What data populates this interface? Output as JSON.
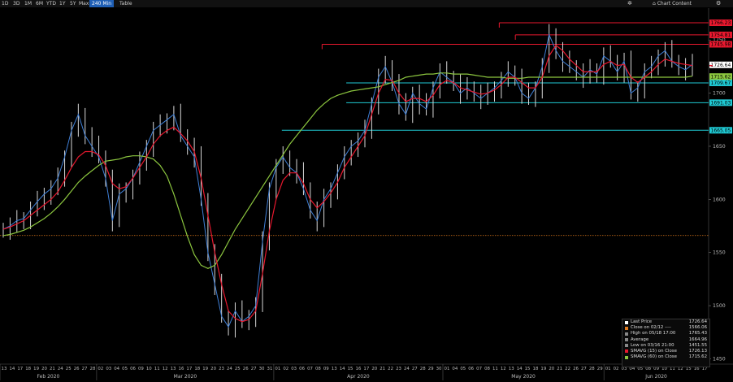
{
  "toolbar": {
    "ranges": [
      "1D",
      "3D",
      "1M",
      "6M",
      "YTD",
      "1Y",
      "5Y",
      "Max"
    ],
    "interval": "240 Min",
    "table": "Table",
    "chart_content": "Chart Content"
  },
  "colors": {
    "price": "#3f7fd6",
    "sma15": "#e8182e",
    "sma60": "#8cc63f",
    "hline_red": "#e8182e",
    "hline_cyan": "#1fc9d3",
    "close_line": "#e07a1e",
    "last_price_tag": "#ffffff"
  },
  "chart_data": {
    "type": "line",
    "ylim": [
      1445,
      1780
    ],
    "y_ticks": [
      1450,
      1500,
      1550,
      1600,
      1650,
      1700,
      1750
    ],
    "x_day_labels": [
      "13",
      "14",
      "17",
      "18",
      "19",
      "20",
      "21",
      "24",
      "25",
      "26",
      "27",
      "28",
      "02",
      "03",
      "04",
      "05",
      "06",
      "09",
      "10",
      "11",
      "12",
      "13",
      "16",
      "17",
      "18",
      "19",
      "20",
      "23",
      "24",
      "25",
      "26",
      "27",
      "30",
      "31",
      "01",
      "02",
      "03",
      "06",
      "07",
      "08",
      "09",
      "13",
      "14",
      "15",
      "16",
      "17",
      "20",
      "21",
      "22",
      "23",
      "24",
      "27",
      "28",
      "29",
      "30",
      "01",
      "04",
      "05",
      "06",
      "07",
      "08",
      "11",
      "12",
      "13",
      "14",
      "15",
      "18",
      "19",
      "20",
      "21",
      "22",
      "26",
      "27",
      "28",
      "29",
      "01",
      "02",
      "03",
      "04",
      "05",
      "08",
      "09",
      "10",
      "11",
      "12",
      "15",
      "16",
      "17"
    ],
    "months": [
      {
        "label": "Feb 2020",
        "start_day": 0
      },
      {
        "label": "Mar 2020",
        "start_day": 12
      },
      {
        "label": "Apr 2020",
        "start_day": 34
      },
      {
        "label": "May 2020",
        "start_day": 55
      },
      {
        "label": "Jun 2020",
        "start_day": 75
      }
    ],
    "series": [
      {
        "name": "Close",
        "values": [
          1572,
          1575,
          1580,
          1582,
          1590,
          1598,
          1605,
          1610,
          1620,
          1640,
          1665,
          1680,
          1660,
          1650,
          1640,
          1620,
          1580,
          1605,
          1610,
          1620,
          1635,
          1650,
          1665,
          1670,
          1675,
          1680,
          1660,
          1650,
          1640,
          1600,
          1550,
          1520,
          1490,
          1480,
          1495,
          1485,
          1490,
          1500,
          1560,
          1610,
          1630,
          1640,
          1630,
          1625,
          1610,
          1590,
          1580,
          1600,
          1610,
          1625,
          1640,
          1650,
          1655,
          1665,
          1690,
          1715,
          1725,
          1710,
          1690,
          1680,
          1700,
          1690,
          1685,
          1705,
          1720,
          1715,
          1710,
          1700,
          1705,
          1700,
          1695,
          1700,
          1705,
          1712,
          1720,
          1715,
          1700,
          1695,
          1705,
          1725,
          1755,
          1740,
          1730,
          1725,
          1720,
          1715,
          1722,
          1718,
          1735,
          1730,
          1720,
          1730,
          1700,
          1705,
          1720,
          1725,
          1735,
          1740,
          1730,
          1725,
          1722,
          1727
        ]
      },
      {
        "name": "SMAVG (15) on Close",
        "values": [
          1572,
          1574,
          1577,
          1580,
          1585,
          1590,
          1595,
          1600,
          1607,
          1618,
          1630,
          1640,
          1645,
          1645,
          1642,
          1632,
          1615,
          1610,
          1612,
          1620,
          1630,
          1640,
          1652,
          1660,
          1665,
          1668,
          1662,
          1655,
          1645,
          1620,
          1585,
          1550,
          1520,
          1495,
          1488,
          1485,
          1487,
          1495,
          1530,
          1570,
          1600,
          1618,
          1625,
          1625,
          1615,
          1600,
          1592,
          1598,
          1606,
          1616,
          1630,
          1640,
          1650,
          1660,
          1680,
          1700,
          1713,
          1712,
          1700,
          1692,
          1695,
          1695,
          1692,
          1698,
          1708,
          1712,
          1710,
          1705,
          1703,
          1701,
          1699,
          1700,
          1703,
          1708,
          1715,
          1715,
          1710,
          1705,
          1705,
          1715,
          1735,
          1745,
          1740,
          1732,
          1726,
          1720,
          1720,
          1720,
          1727,
          1730,
          1726,
          1727,
          1715,
          1710,
          1715,
          1720,
          1727,
          1732,
          1730,
          1728,
          1727,
          1726
        ]
      },
      {
        "name": "SMAVG (60) on Close",
        "values": [
          1566,
          1567,
          1569,
          1571,
          1574,
          1578,
          1582,
          1587,
          1593,
          1600,
          1608,
          1616,
          1622,
          1627,
          1632,
          1636,
          1637,
          1638,
          1640,
          1641,
          1641,
          1640,
          1638,
          1632,
          1622,
          1605,
          1585,
          1565,
          1548,
          1538,
          1535,
          1538,
          1548,
          1560,
          1572,
          1582,
          1592,
          1602,
          1612,
          1622,
          1632,
          1642,
          1652,
          1660,
          1668,
          1676,
          1684,
          1690,
          1695,
          1698,
          1700,
          1702,
          1703,
          1704,
          1705,
          1706,
          1708,
          1710,
          1712,
          1715,
          1716,
          1717,
          1718,
          1718,
          1719,
          1719,
          1718,
          1718,
          1718,
          1717,
          1716,
          1715,
          1715,
          1715,
          1714,
          1714,
          1714,
          1715,
          1715,
          1715,
          1715,
          1715,
          1715,
          1715,
          1715,
          1715,
          1715,
          1715,
          1715,
          1715,
          1715,
          1715,
          1715,
          1715,
          1715,
          1715,
          1715,
          1715,
          1715,
          1715,
          1715,
          1716
        ]
      }
    ],
    "h_lines": [
      {
        "value": 1766.23,
        "label": "1766.23",
        "color": "red",
        "from_day": 62
      },
      {
        "value": 1754.81,
        "label": "1754.81",
        "color": "red",
        "from_day": 64
      },
      {
        "value": 1745.98,
        "label": "1745.98",
        "color": "red",
        "from_day": 40
      },
      {
        "value": 1709.67,
        "label": "1709.67",
        "color": "cyan",
        "from_day": 43
      },
      {
        "value": 1691.03,
        "label": "1691.03",
        "color": "cyan",
        "from_day": 43
      },
      {
        "value": 1665.05,
        "label": "1665.05",
        "color": "cyan",
        "from_day": 35
      },
      {
        "value": 1566.06,
        "label": "",
        "color": "close",
        "from_day": 0
      }
    ],
    "right_tags": [
      {
        "value": 1726.64,
        "label": "1726.64",
        "kind": "last"
      },
      {
        "value": 1715.62,
        "label": "1715.62",
        "kind": "sma60"
      },
      {
        "value": 1726.13,
        "label": "",
        "kind": "sma15"
      }
    ]
  },
  "legend": [
    {
      "label": "Last Price",
      "value": "1726.64",
      "swatch": "#ffffff"
    },
    {
      "label": "Close on 02/12 ----",
      "value": "1566.06",
      "swatch": "#e07a1e"
    },
    {
      "label": "High on 05/18 17:00",
      "value": "1765.43",
      "swatch": "#888888"
    },
    {
      "label": "Average",
      "value": "1664.96",
      "swatch": "#888888"
    },
    {
      "label": "Low on 03/16 21:00",
      "value": "1451.55",
      "swatch": "#888888"
    },
    {
      "label": "SMAVG (15) on Close",
      "value": "1726.13",
      "swatch": "#e8182e"
    },
    {
      "label": "SMAVG (60) on Close",
      "value": "1715.62",
      "swatch": "#8cc63f"
    }
  ]
}
